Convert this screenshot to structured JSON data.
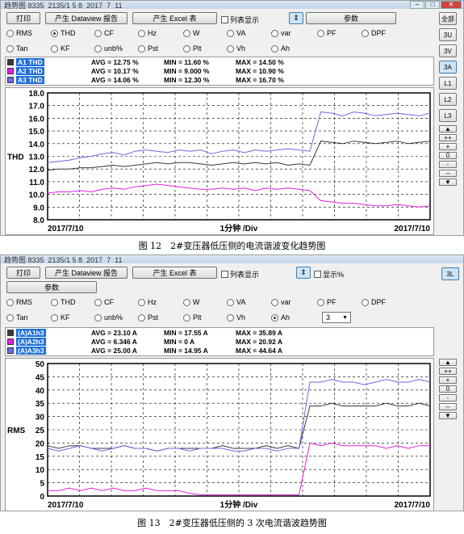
{
  "window1": {
    "title": "趋势图 8335_2135/1 5 8_2017_7_11",
    "buttons": {
      "print": "打印",
      "dataview": "产生 Dataview 报告",
      "excel": "产生 Excel 表",
      "params": "参数"
    },
    "list_label": "列表显示",
    "side_buttons": [
      "全部",
      "3U",
      "3V",
      "3A",
      "L1",
      "L2",
      "L3"
    ],
    "side_selected": "3A",
    "radios_row1": [
      "RMS",
      "THD",
      "CF",
      "Hz",
      "W",
      "VA",
      "var",
      "PF",
      "DPF"
    ],
    "radios_row2": [
      "Tan",
      "KF",
      "unb%",
      "Pst",
      "Plt",
      "Vh",
      "Ah"
    ],
    "selected_radio": "THD",
    "legend": [
      {
        "name": "A1 THD",
        "avg": "AVG = 12.75 %",
        "min": "MIN = 11.60 %",
        "max": "MAX = 14.50 %",
        "color": "#3a3a3a"
      },
      {
        "name": "A2 THD",
        "avg": "AVG = 10.17 %",
        "min": "MIN = 9.000 %",
        "max": "MAX = 10.90 %",
        "color": "#e020e0"
      },
      {
        "name": "A3 THD",
        "avg": "AVG = 14.06 %",
        "min": "MIN = 12.30 %",
        "max": "MAX = 16.70 %",
        "color": "#6a6ae6"
      }
    ],
    "ylabel": "THD",
    "xlabel": "1分钟 /Div",
    "date_left": "2017/7/10",
    "date_right": "2017/7/10",
    "caption": "图 12　2#变压器低压侧的电流谐波变化趋势图"
  },
  "window2": {
    "title": "趋势图 8335_2135/1 5 8_2017_7_11",
    "buttons": {
      "print": "打印",
      "dataview": "产生 Dataview 报告",
      "excel": "产生 Excel 表",
      "params": "参数"
    },
    "list_label": "列表显示",
    "pct_label": "显示%",
    "side_button": "3L",
    "radios_row1": [
      "RMS",
      "THD",
      "CF",
      "Hz",
      "W",
      "VA",
      "var",
      "PF",
      "DPF"
    ],
    "radios_row2": [
      "Tan",
      "KF",
      "unb%",
      "Pst",
      "Plt",
      "Vh",
      "Ah"
    ],
    "selected_radio": "Ah",
    "harmonic_order": "3",
    "legend": [
      {
        "name": "(A)A1h3",
        "avg": "AVG = 23.10 A",
        "min": "MIN = 17.55 A",
        "max": "MAX = 35.89 A",
        "color": "#3a3a3a"
      },
      {
        "name": "(A)A2h3",
        "avg": "AVG = 6.346 A",
        "min": "MIN = 0 A",
        "max": "MAX = 20.92 A",
        "color": "#e020e0"
      },
      {
        "name": "(A)A3h3",
        "avg": "AVG = 25.00 A",
        "min": "MIN = 14.95 A",
        "max": "MAX = 44.64 A",
        "color": "#6a6ae6"
      }
    ],
    "ylabel": "RMS",
    "xlabel": "1分钟 /Div",
    "date_left": "2017/7/10",
    "date_right": "2017/7/10",
    "caption": "图 13　2#变压器低压侧的 3 次电流谐波趋势图"
  },
  "zoom_buttons": [
    "++",
    "+",
    "0",
    "-",
    "--"
  ],
  "chart_data": [
    {
      "type": "line",
      "ylabel": "THD",
      "xlabel": "1分钟 /Div",
      "ylim": [
        8.0,
        18.0
      ],
      "yticks": [
        8.0,
        9.0,
        10.0,
        11.0,
        12.0,
        13.0,
        14.0,
        15.0,
        16.0,
        17.0,
        18.0
      ],
      "grid": true,
      "series": [
        {
          "name": "A1 THD",
          "color": "#3a3a3a",
          "values": [
            11.9,
            12.0,
            12.0,
            12.1,
            12.1,
            12.2,
            12.3,
            12.2,
            12.3,
            12.4,
            12.5,
            12.4,
            12.5,
            12.5,
            12.4,
            12.3,
            12.4,
            12.5,
            12.4,
            12.5,
            12.4,
            12.5,
            12.3,
            12.4,
            12.3,
            14.2,
            14.1,
            14.0,
            14.2,
            14.1,
            14.0,
            14.1,
            14.2,
            14.0,
            14.1,
            14.2
          ]
        },
        {
          "name": "A2 THD",
          "color": "#e020e0",
          "values": [
            10.1,
            10.2,
            10.2,
            10.3,
            10.2,
            10.4,
            10.5,
            10.4,
            10.6,
            10.7,
            10.8,
            10.7,
            10.6,
            10.5,
            10.4,
            10.4,
            10.5,
            10.4,
            10.5,
            10.3,
            10.5,
            10.4,
            10.5,
            10.4,
            10.3,
            9.5,
            9.4,
            9.3,
            9.3,
            9.2,
            9.1,
            9.1,
            9.2,
            9.1,
            9.0,
            9.1
          ]
        },
        {
          "name": "A3 THD",
          "color": "#6a6ae6",
          "values": [
            12.5,
            12.6,
            12.7,
            12.9,
            13.0,
            13.2,
            13.3,
            13.1,
            13.4,
            13.5,
            13.4,
            13.3,
            13.5,
            13.4,
            13.5,
            13.2,
            13.4,
            13.5,
            13.3,
            13.5,
            13.4,
            13.5,
            13.6,
            13.5,
            13.4,
            16.5,
            16.4,
            16.2,
            16.5,
            16.4,
            16.2,
            16.3,
            16.4,
            16.3,
            16.2,
            16.4
          ]
        }
      ]
    },
    {
      "type": "line",
      "ylabel": "RMS",
      "xlabel": "1分钟 /Div",
      "ylim": [
        0,
        50
      ],
      "yticks": [
        0,
        5,
        10,
        15,
        20,
        25,
        30,
        35,
        40,
        45,
        50
      ],
      "grid": true,
      "series": [
        {
          "name": "(A)A1h3",
          "color": "#3a3a3a",
          "values": [
            19,
            18,
            19,
            19,
            18,
            18,
            18,
            19,
            18,
            18,
            17,
            18,
            18,
            18,
            18,
            18,
            19,
            18,
            18,
            18,
            19,
            18,
            19,
            18,
            34,
            34,
            35,
            34,
            34,
            34,
            34,
            35,
            34,
            34,
            35,
            34
          ]
        },
        {
          "name": "(A)A2h3",
          "color": "#e020e0",
          "values": [
            2,
            2,
            3,
            2,
            3,
            2,
            3,
            2,
            2,
            3,
            2,
            2,
            2,
            1,
            0.5,
            0.5,
            0.5,
            0.5,
            0.5,
            0.5,
            0.5,
            0.5,
            0.5,
            0.5,
            20,
            19,
            20,
            19,
            19,
            19,
            19,
            18,
            19,
            18,
            19,
            19
          ]
        },
        {
          "name": "(A)A3h3",
          "color": "#6a6ae6",
          "values": [
            18,
            17,
            18,
            19,
            18,
            17,
            18,
            19,
            18,
            18,
            17,
            18,
            18,
            17,
            18,
            18,
            18,
            17,
            17,
            18,
            18,
            17,
            18,
            18,
            43,
            43,
            44,
            43,
            43,
            42,
            43,
            44,
            43,
            43,
            44,
            43
          ]
        }
      ]
    }
  ]
}
